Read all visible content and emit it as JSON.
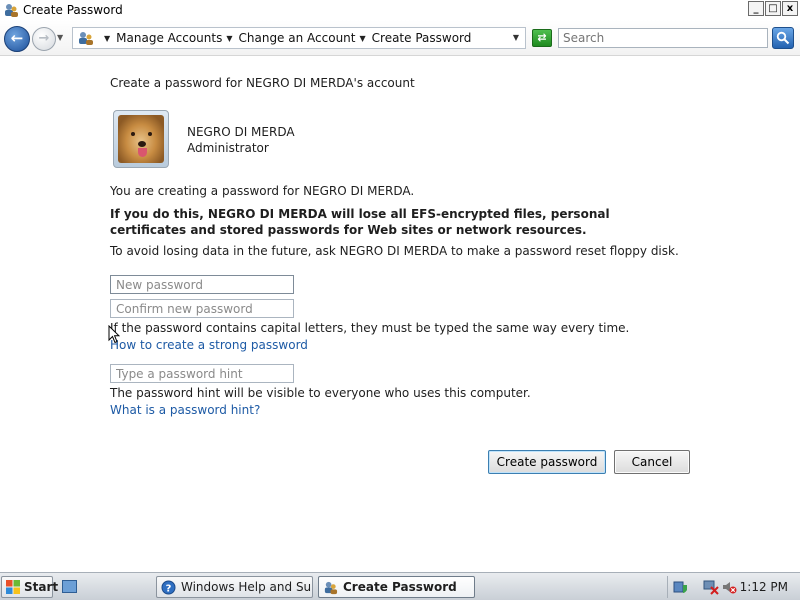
{
  "window": {
    "title": "Create Password",
    "buttons": {
      "minimize": "_",
      "maximize": "□",
      "close": "x"
    }
  },
  "nav": {
    "breadcrumbs": [
      "Manage Accounts",
      "Change an Account",
      "Create Password"
    ],
    "search_placeholder": "Search"
  },
  "page": {
    "heading": "Create a password for NEGRO DI MERDA's account",
    "user_name": "NEGRO DI MERDA",
    "user_role": "Administrator",
    "intro": "You are creating a password for NEGRO DI MERDA.",
    "warning": "If you do this, NEGRO DI MERDA will lose all EFS-encrypted files, personal certificates and stored passwords for Web sites or network resources.",
    "advice": "To avoid losing data in the future, ask NEGRO DI MERDA to make a password reset floppy disk.",
    "new_password_placeholder": "New password",
    "confirm_password_placeholder": "Confirm new password",
    "caps_note": "If the password contains capital letters, they must be typed the same way every time.",
    "strong_link": "How to create a strong password",
    "hint_placeholder": "Type a password hint",
    "hint_note": "The password hint will be visible to everyone who uses this computer.",
    "hint_link": "What is a password hint?",
    "create_button": "Create password",
    "cancel_button": "Cancel"
  },
  "taskbar": {
    "start_label": "Start",
    "tasks": [
      "Windows Help and Sup...",
      "Create Password"
    ],
    "clock": "1:12 PM"
  }
}
